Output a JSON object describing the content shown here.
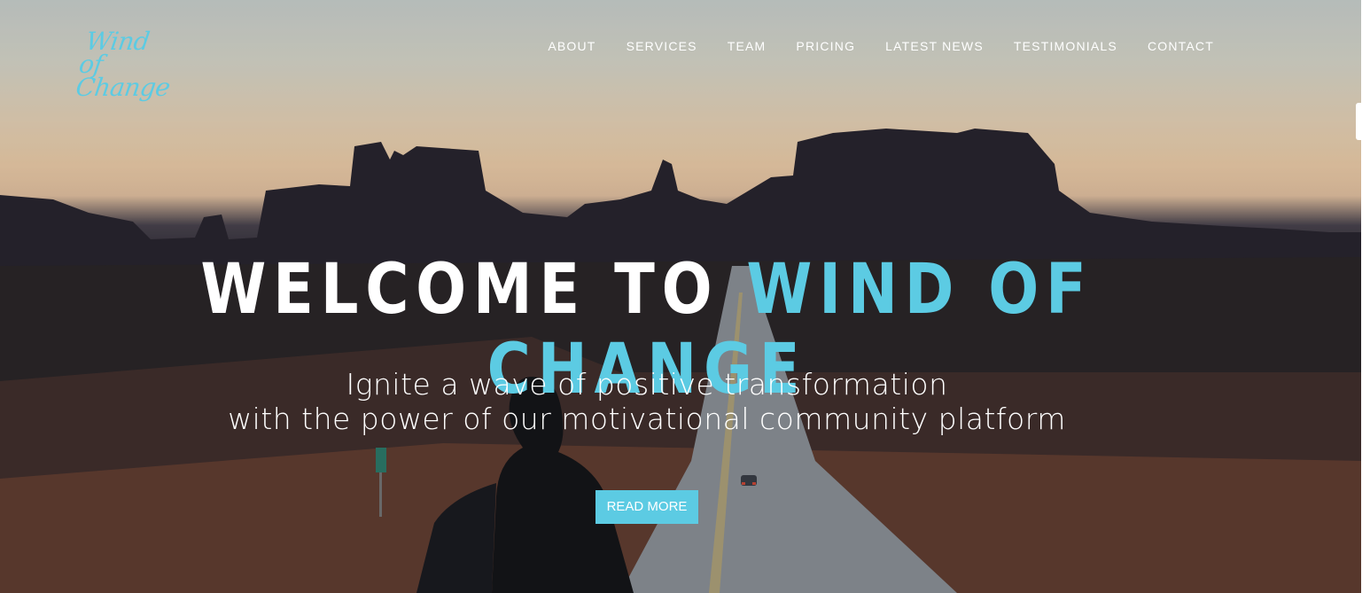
{
  "brand": {
    "logo_line1": "Wind",
    "logo_line2": "of Change",
    "accent_color": "#5ccbe3"
  },
  "nav": {
    "items": [
      {
        "label": "ABOUT"
      },
      {
        "label": "SERVICES"
      },
      {
        "label": "TEAM"
      },
      {
        "label": "PRICING"
      },
      {
        "label": "LATEST NEWS"
      },
      {
        "label": "TESTIMONIALS"
      },
      {
        "label": "CONTACT"
      }
    ]
  },
  "hero": {
    "headline_white": "WELCOME TO ",
    "headline_accent": "WIND OF CHANGE",
    "subtitle_line1": "Ignite a wave of positive transformation",
    "subtitle_line2": "with the power of our motivational community platform",
    "cta_label": "READ MORE"
  }
}
